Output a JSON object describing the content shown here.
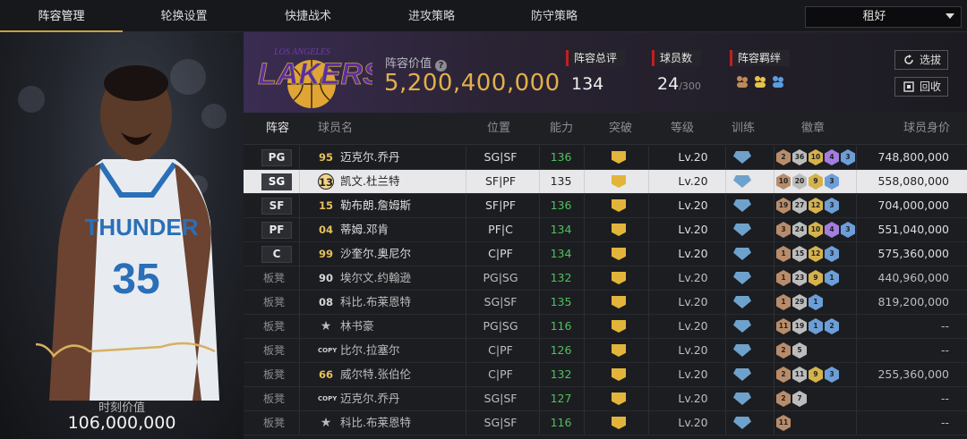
{
  "tabs": [
    "阵容管理",
    "轮换设置",
    "快捷战术",
    "进攻策略",
    "防守策略"
  ],
  "dropdown": {
    "value": "租好"
  },
  "left": {
    "moment_label": "时刻价值",
    "moment_value": "106,000,000",
    "jersey_text": "THUNDER",
    "jersey_number": "35"
  },
  "summary": {
    "team_name": "LAKERS",
    "team_city": "LOS ANGELES",
    "value_label": "阵容价值",
    "value": "5,200,400,000",
    "rating_label": "阵容总评",
    "rating": "134",
    "count_label": "球员数",
    "count": "24",
    "count_max": "/300",
    "bond_label": "阵容羁绊",
    "btn_pick": "选拔",
    "btn_recycle": "回收"
  },
  "table": {
    "headers": {
      "lineup": "阵容",
      "name": "球员名",
      "pos": "位置",
      "ability": "能力",
      "breakthrough": "突破",
      "level": "等级",
      "training": "训练",
      "badge": "徽章",
      "value": "球员身价"
    },
    "rows": [
      {
        "slot": "PG",
        "num": "95",
        "num_style": "gold",
        "name": "迈克尔.乔丹",
        "pos": "SG|SF",
        "ability": "136",
        "level": "Lv.20",
        "badges": [
          [
            "c",
            "2"
          ],
          [
            "s",
            "36"
          ],
          [
            "g",
            "10"
          ],
          [
            "p",
            "4"
          ],
          [
            "b",
            "3"
          ]
        ],
        "value": "748,800,000"
      },
      {
        "slot": "SG",
        "num": "13",
        "num_style": "sel",
        "name": "凯文.杜兰特",
        "pos": "SF|PF",
        "ability": "135",
        "level": "Lv.20",
        "badges": [
          [
            "c",
            "10"
          ],
          [
            "s",
            "20"
          ],
          [
            "g",
            "9"
          ],
          [
            "b",
            "3"
          ]
        ],
        "value": "558,080,000",
        "selected": true
      },
      {
        "slot": "SF",
        "num": "15",
        "num_style": "gold",
        "name": "勒布朗.詹姆斯",
        "pos": "SF|PF",
        "ability": "136",
        "level": "Lv.20",
        "badges": [
          [
            "c",
            "19"
          ],
          [
            "s",
            "27"
          ],
          [
            "g",
            "12"
          ],
          [
            "b",
            "3"
          ]
        ],
        "value": "704,000,000"
      },
      {
        "slot": "PF",
        "num": "04",
        "num_style": "gold",
        "name": "蒂姆.邓肯",
        "pos": "PF|C",
        "ability": "134",
        "level": "Lv.20",
        "badges": [
          [
            "c",
            "3"
          ],
          [
            "s",
            "24"
          ],
          [
            "g",
            "10"
          ],
          [
            "p",
            "4"
          ],
          [
            "b",
            "3"
          ]
        ],
        "value": "551,040,000"
      },
      {
        "slot": "C",
        "num": "99",
        "num_style": "gold",
        "name": "沙奎尔.奥尼尔",
        "pos": "C|PF",
        "ability": "134",
        "level": "Lv.20",
        "badges": [
          [
            "c",
            "1"
          ],
          [
            "s",
            "15"
          ],
          [
            "g",
            "12"
          ],
          [
            "b",
            "3"
          ]
        ],
        "value": "575,360,000"
      },
      {
        "slot": "板凳",
        "num": "90",
        "num_style": "silver",
        "name": "埃尔文.约翰逊",
        "pos": "PG|SG",
        "ability": "132",
        "level": "Lv.20",
        "badges": [
          [
            "c",
            "1"
          ],
          [
            "s",
            "23"
          ],
          [
            "g",
            "9"
          ],
          [
            "b",
            "1"
          ]
        ],
        "value": "440,960,000"
      },
      {
        "slot": "板凳",
        "num": "08",
        "num_style": "silver",
        "name": "科比.布莱恩特",
        "pos": "SG|SF",
        "ability": "135",
        "level": "Lv.20",
        "badges": [
          [
            "c",
            "1"
          ],
          [
            "s",
            "29"
          ],
          [
            "b",
            "1"
          ]
        ],
        "value": "819,200,000"
      },
      {
        "slot": "板凳",
        "num": "★",
        "num_style": "star",
        "name": "林书豪",
        "pos": "PG|SG",
        "ability": "116",
        "level": "Lv.20",
        "badges": [
          [
            "c",
            "11"
          ],
          [
            "s",
            "19"
          ],
          [
            "b",
            "1"
          ],
          [
            "b",
            "2"
          ]
        ],
        "value": "--"
      },
      {
        "slot": "板凳",
        "num": "COPY",
        "num_style": "copy",
        "name": "比尔.拉塞尔",
        "pos": "C|PF",
        "ability": "126",
        "level": "Lv.20",
        "badges": [
          [
            "c",
            "2"
          ],
          [
            "s",
            "5"
          ]
        ],
        "value": "--"
      },
      {
        "slot": "板凳",
        "num": "66",
        "num_style": "gold",
        "name": "威尔特.张伯伦",
        "pos": "C|PF",
        "ability": "132",
        "level": "Lv.20",
        "badges": [
          [
            "c",
            "2"
          ],
          [
            "s",
            "11"
          ],
          [
            "g",
            "9"
          ],
          [
            "b",
            "3"
          ]
        ],
        "value": "255,360,000"
      },
      {
        "slot": "板凳",
        "num": "COPY",
        "num_style": "copy",
        "name": "迈克尔.乔丹",
        "pos": "SG|SF",
        "ability": "127",
        "level": "Lv.20",
        "badges": [
          [
            "c",
            "2"
          ],
          [
            "s",
            "7"
          ]
        ],
        "value": "--"
      },
      {
        "slot": "板凳",
        "num": "★",
        "num_style": "star",
        "name": "科比.布莱恩特",
        "pos": "SG|SF",
        "ability": "116",
        "level": "Lv.20",
        "badges": [
          [
            "c",
            "11"
          ]
        ],
        "value": "--"
      }
    ]
  },
  "colors": {
    "gold": "#e2b04a",
    "accent_red": "#c02020",
    "ability_green": "#4fc060",
    "selected_row": "#e8e8ea"
  },
  "icons": [
    "help-icon",
    "refresh-icon",
    "recycle-icon",
    "bond-icon",
    "chevron-down-icon",
    "breakthrough-crown-icon",
    "training-icon",
    "badge-hex-icon",
    "star-icon"
  ]
}
